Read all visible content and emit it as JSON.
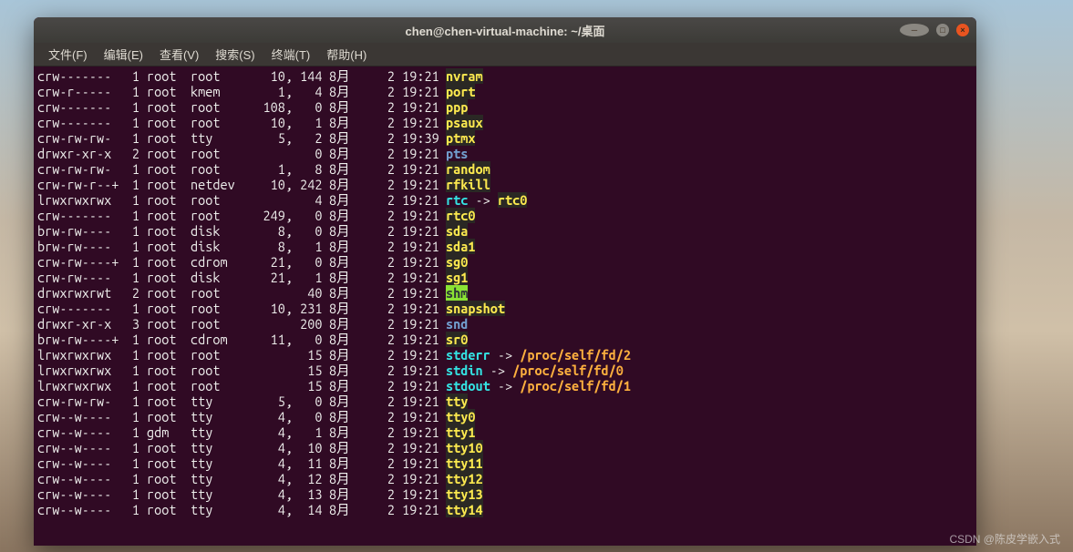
{
  "window": {
    "title": "chen@chen-virtual-machine: ~/桌面"
  },
  "menu": {
    "file": "文件(F)",
    "edit": "编辑(E)",
    "view": "查看(V)",
    "search": "搜索(S)",
    "terminal": "终端(T)",
    "help": "帮助(H)"
  },
  "listing": [
    {
      "perms": "crw-------",
      "links": "1",
      "owner": "root",
      "group": "root",
      "maj": "10,",
      "min": "144",
      "month": "8月",
      "day": "2",
      "time": "19:21",
      "name": "nvram",
      "cls": "c-dev"
    },
    {
      "perms": "crw-r-----",
      "links": "1",
      "owner": "root",
      "group": "kmem",
      "maj": "1,",
      "min": "4",
      "month": "8月",
      "day": "2",
      "time": "19:21",
      "name": "port",
      "cls": "c-dev"
    },
    {
      "perms": "crw-------",
      "links": "1",
      "owner": "root",
      "group": "root",
      "maj": "108,",
      "min": "0",
      "month": "8月",
      "day": "2",
      "time": "19:21",
      "name": "ppp",
      "cls": "c-dev"
    },
    {
      "perms": "crw-------",
      "links": "1",
      "owner": "root",
      "group": "root",
      "maj": "10,",
      "min": "1",
      "month": "8月",
      "day": "2",
      "time": "19:21",
      "name": "psaux",
      "cls": "c-dev"
    },
    {
      "perms": "crw-rw-rw-",
      "links": "1",
      "owner": "root",
      "group": "tty",
      "maj": "5,",
      "min": "2",
      "month": "8月",
      "day": "2",
      "time": "19:39",
      "name": "ptmx",
      "cls": "c-dev"
    },
    {
      "perms": "drwxr-xr-x",
      "links": "2",
      "owner": "root",
      "group": "root",
      "maj": "",
      "min": "0",
      "month": "8月",
      "day": "2",
      "time": "19:21",
      "name": "pts",
      "cls": "c-dir"
    },
    {
      "perms": "crw-rw-rw-",
      "links": "1",
      "owner": "root",
      "group": "root",
      "maj": "1,",
      "min": "8",
      "month": "8月",
      "day": "2",
      "time": "19:21",
      "name": "random",
      "cls": "c-dev"
    },
    {
      "perms": "crw-rw-r--+",
      "links": "1",
      "owner": "root",
      "group": "netdev",
      "maj": "10,",
      "min": "242",
      "month": "8月",
      "day": "2",
      "time": "19:21",
      "name": "rfkill",
      "cls": "c-dev"
    },
    {
      "perms": "lrwxrwxrwx",
      "links": "1",
      "owner": "root",
      "group": "root",
      "maj": "",
      "min": "4",
      "month": "8月",
      "day": "2",
      "time": "19:21",
      "name": "rtc",
      "cls": "c-link",
      "arrow": " -> ",
      "target": "rtc0",
      "tcls": "c-dev"
    },
    {
      "perms": "crw-------",
      "links": "1",
      "owner": "root",
      "group": "root",
      "maj": "249,",
      "min": "0",
      "month": "8月",
      "day": "2",
      "time": "19:21",
      "name": "rtc0",
      "cls": "c-dev"
    },
    {
      "perms": "brw-rw----",
      "links": "1",
      "owner": "root",
      "group": "disk",
      "maj": "8,",
      "min": "0",
      "month": "8月",
      "day": "2",
      "time": "19:21",
      "name": "sda",
      "cls": "c-dev"
    },
    {
      "perms": "brw-rw----",
      "links": "1",
      "owner": "root",
      "group": "disk",
      "maj": "8,",
      "min": "1",
      "month": "8月",
      "day": "2",
      "time": "19:21",
      "name": "sda1",
      "cls": "c-dev"
    },
    {
      "perms": "crw-rw----+",
      "links": "1",
      "owner": "root",
      "group": "cdrom",
      "maj": "21,",
      "min": "0",
      "month": "8月",
      "day": "2",
      "time": "19:21",
      "name": "sg0",
      "cls": "c-dev"
    },
    {
      "perms": "crw-rw----",
      "links": "1",
      "owner": "root",
      "group": "disk",
      "maj": "21,",
      "min": "1",
      "month": "8月",
      "day": "2",
      "time": "19:21",
      "name": "sg1",
      "cls": "c-dev"
    },
    {
      "perms": "drwxrwxrwt",
      "links": "2",
      "owner": "root",
      "group": "root",
      "maj": "",
      "min": "40",
      "month": "8月",
      "day": "2",
      "time": "19:21",
      "name": "shm",
      "cls": "c-sticky"
    },
    {
      "perms": "crw-------",
      "links": "1",
      "owner": "root",
      "group": "root",
      "maj": "10,",
      "min": "231",
      "month": "8月",
      "day": "2",
      "time": "19:21",
      "name": "snapshot",
      "cls": "c-dev"
    },
    {
      "perms": "drwxr-xr-x",
      "links": "3",
      "owner": "root",
      "group": "root",
      "maj": "",
      "min": "200",
      "month": "8月",
      "day": "2",
      "time": "19:21",
      "name": "snd",
      "cls": "c-dir"
    },
    {
      "perms": "brw-rw----+",
      "links": "1",
      "owner": "root",
      "group": "cdrom",
      "maj": "11,",
      "min": "0",
      "month": "8月",
      "day": "2",
      "time": "19:21",
      "name": "sr0",
      "cls": "c-dev"
    },
    {
      "perms": "lrwxrwxrwx",
      "links": "1",
      "owner": "root",
      "group": "root",
      "maj": "",
      "min": "15",
      "month": "8月",
      "day": "2",
      "time": "19:21",
      "name": "stderr",
      "cls": "c-link",
      "arrow": " -> ",
      "target": "/proc/self/fd/2",
      "tcls": "c-target"
    },
    {
      "perms": "lrwxrwxrwx",
      "links": "1",
      "owner": "root",
      "group": "root",
      "maj": "",
      "min": "15",
      "month": "8月",
      "day": "2",
      "time": "19:21",
      "name": "stdin",
      "cls": "c-link",
      "arrow": " -> ",
      "target": "/proc/self/fd/0",
      "tcls": "c-target"
    },
    {
      "perms": "lrwxrwxrwx",
      "links": "1",
      "owner": "root",
      "group": "root",
      "maj": "",
      "min": "15",
      "month": "8月",
      "day": "2",
      "time": "19:21",
      "name": "stdout",
      "cls": "c-link",
      "arrow": " -> ",
      "target": "/proc/self/fd/1",
      "tcls": "c-target"
    },
    {
      "perms": "crw-rw-rw-",
      "links": "1",
      "owner": "root",
      "group": "tty",
      "maj": "5,",
      "min": "0",
      "month": "8月",
      "day": "2",
      "time": "19:21",
      "name": "tty",
      "cls": "c-dev"
    },
    {
      "perms": "crw--w----",
      "links": "1",
      "owner": "root",
      "group": "tty",
      "maj": "4,",
      "min": "0",
      "month": "8月",
      "day": "2",
      "time": "19:21",
      "name": "tty0",
      "cls": "c-dev"
    },
    {
      "perms": "crw--w----",
      "links": "1",
      "owner": "gdm",
      "group": "tty",
      "maj": "4,",
      "min": "1",
      "month": "8月",
      "day": "2",
      "time": "19:21",
      "name": "tty1",
      "cls": "c-dev"
    },
    {
      "perms": "crw--w----",
      "links": "1",
      "owner": "root",
      "group": "tty",
      "maj": "4,",
      "min": "10",
      "month": "8月",
      "day": "2",
      "time": "19:21",
      "name": "tty10",
      "cls": "c-dev"
    },
    {
      "perms": "crw--w----",
      "links": "1",
      "owner": "root",
      "group": "tty",
      "maj": "4,",
      "min": "11",
      "month": "8月",
      "day": "2",
      "time": "19:21",
      "name": "tty11",
      "cls": "c-dev"
    },
    {
      "perms": "crw--w----",
      "links": "1",
      "owner": "root",
      "group": "tty",
      "maj": "4,",
      "min": "12",
      "month": "8月",
      "day": "2",
      "time": "19:21",
      "name": "tty12",
      "cls": "c-dev"
    },
    {
      "perms": "crw--w----",
      "links": "1",
      "owner": "root",
      "group": "tty",
      "maj": "4,",
      "min": "13",
      "month": "8月",
      "day": "2",
      "time": "19:21",
      "name": "tty13",
      "cls": "c-dev"
    },
    {
      "perms": "crw--w----",
      "links": "1",
      "owner": "root",
      "group": "tty",
      "maj": "4,",
      "min": "14",
      "month": "8月",
      "day": "2",
      "time": "19:21",
      "name": "tty14",
      "cls": "c-dev"
    }
  ],
  "watermark": "CSDN @陈皮学嵌入式"
}
